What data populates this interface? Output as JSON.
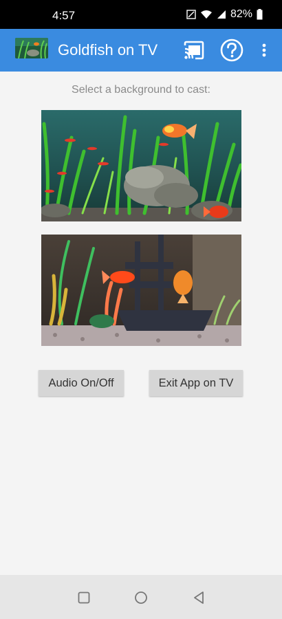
{
  "status_bar": {
    "time": "4:57",
    "battery": "82%"
  },
  "app_bar": {
    "title": "Goldfish on TV",
    "icons": [
      "aquarium-logo-icon",
      "cast-icon",
      "help-icon",
      "more-vert-icon"
    ]
  },
  "main": {
    "prompt": "Select a background to cast:",
    "backgrounds": [
      "aquarium-plants-rock",
      "aquarium-shipwreck-goldfish"
    ],
    "buttons": {
      "audio": "Audio On/Off",
      "exit": "Exit App on TV"
    }
  },
  "nav_bar": {
    "icons": [
      "recents-icon",
      "home-icon",
      "back-icon"
    ]
  },
  "colors": {
    "app_bar": "#3a8be0",
    "status_bar": "#000000",
    "background": "#f4f4f4",
    "button": "#d6d6d6"
  }
}
